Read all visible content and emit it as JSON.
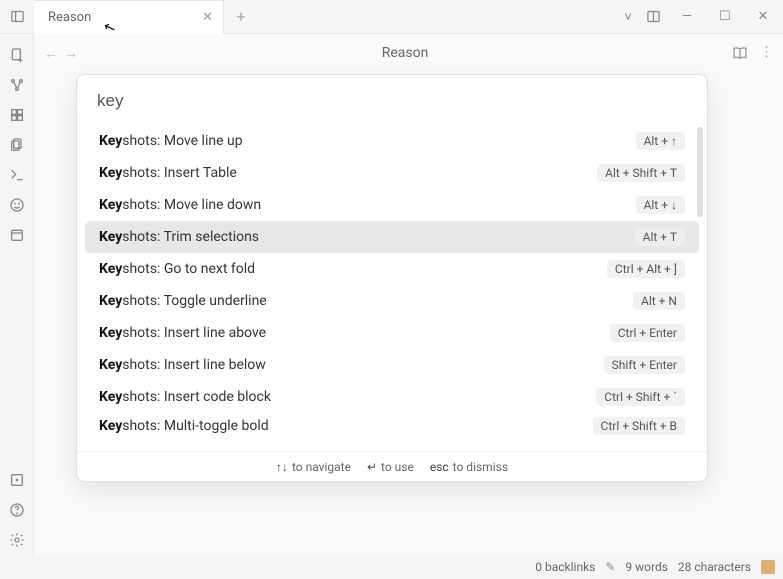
{
  "tab": {
    "title": "Reason"
  },
  "doc": {
    "title": "Reason"
  },
  "palette": {
    "query": "key",
    "items": [
      {
        "prefix": "Key",
        "rest": "shots: Move line up",
        "shortcut": "Alt + ↑",
        "selected": false
      },
      {
        "prefix": "Key",
        "rest": "shots: Insert Table",
        "shortcut": "Alt + Shift + T",
        "selected": false
      },
      {
        "prefix": "Key",
        "rest": "shots: Move line down",
        "shortcut": "Alt + ↓",
        "selected": false
      },
      {
        "prefix": "Key",
        "rest": "shots: Trim selections",
        "shortcut": "Alt + T",
        "selected": true
      },
      {
        "prefix": "Key",
        "rest": "shots: Go to next fold",
        "shortcut": "Ctrl + Alt + ]",
        "selected": false
      },
      {
        "prefix": "Key",
        "rest": "shots: Toggle underline",
        "shortcut": "Alt + N",
        "selected": false
      },
      {
        "prefix": "Key",
        "rest": "shots: Insert line above",
        "shortcut": "Ctrl + Enter",
        "selected": false
      },
      {
        "prefix": "Key",
        "rest": "shots: Insert line below",
        "shortcut": "Shift + Enter",
        "selected": false
      },
      {
        "prefix": "Key",
        "rest": "shots: Insert code block",
        "shortcut": "Ctrl + Shift + `",
        "selected": false
      },
      {
        "prefix": "Key",
        "rest": "shots: Multi-toggle bold",
        "shortcut": "Ctrl + Shift + B",
        "selected": false
      }
    ],
    "footer": {
      "nav": "to navigate",
      "use": "to use",
      "dismiss": "to dismiss",
      "nav_sym": "↑↓",
      "use_sym": "↵",
      "dismiss_sym": "esc"
    }
  },
  "status": {
    "backlinks": "0 backlinks",
    "words": "9 words",
    "chars": "28 characters"
  }
}
